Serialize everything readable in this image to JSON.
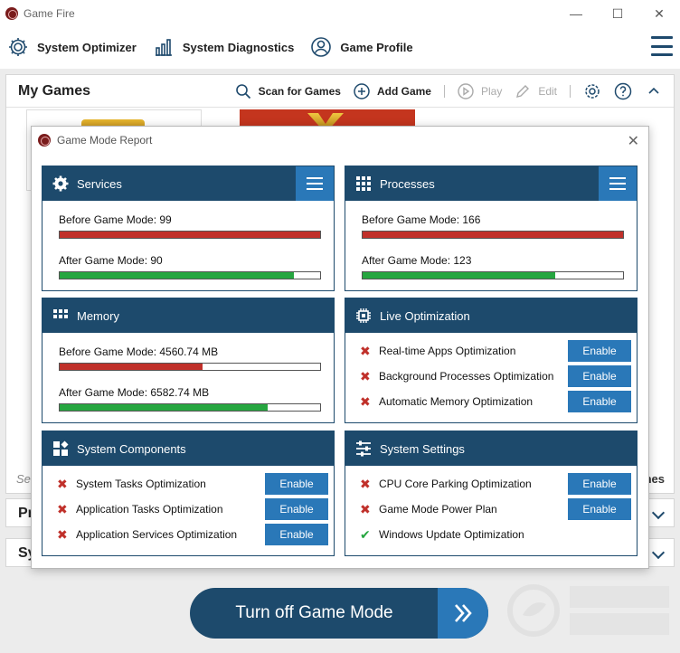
{
  "window": {
    "title": "Game Fire"
  },
  "nav": {
    "items": [
      {
        "label": "System Optimizer",
        "icon": "gear-icon"
      },
      {
        "label": "System Diagnostics",
        "icon": "bar-chart-icon"
      },
      {
        "label": "Game Profile",
        "icon": "user-icon"
      }
    ]
  },
  "games": {
    "title": "My Games",
    "scan_label": "Scan for Games",
    "add_label": "Add Game",
    "play_label": "Play",
    "edit_label": "Edit",
    "search_hint": "Se",
    "right_hint": "nes"
  },
  "collapsed": [
    {
      "label": "Pr"
    },
    {
      "label": "Sy"
    }
  ],
  "turnoff": {
    "label": "Turn off Game Mode"
  },
  "dialog": {
    "title": "Game Mode Report",
    "services": {
      "title": "Services",
      "before_label": "Before Game Mode: 99",
      "after_label": "After Game Mode: 90",
      "after_fraction": 0.9
    },
    "processes": {
      "title": "Processes",
      "before_label": "Before Game Mode: 166",
      "after_label": "After Game Mode: 123",
      "after_fraction": 0.74
    },
    "memory": {
      "title": "Memory",
      "before_label": "Before Game Mode: 4560.74 MB",
      "after_label": "After Game Mode: 6582.74 MB",
      "before_fraction": 0.55,
      "after_fraction": 0.8
    },
    "live": {
      "title": "Live Optimization",
      "rows": [
        {
          "label": "Real-time Apps Optimization",
          "status": "x",
          "action": "Enable"
        },
        {
          "label": "Background Processes Optimization",
          "status": "x",
          "action": "Enable"
        },
        {
          "label": "Automatic Memory Optimization",
          "status": "x",
          "action": "Enable"
        }
      ]
    },
    "components": {
      "title": "System Components",
      "rows": [
        {
          "label": "System Tasks Optimization",
          "status": "x",
          "action": "Enable"
        },
        {
          "label": "Application Tasks Optimization",
          "status": "x",
          "action": "Enable"
        },
        {
          "label": "Application Services Optimization",
          "status": "x",
          "action": "Enable"
        }
      ]
    },
    "settings": {
      "title": "System Settings",
      "rows": [
        {
          "label": "CPU Core Parking Optimization",
          "status": "x",
          "action": "Enable"
        },
        {
          "label": "Game Mode Power Plan",
          "status": "x",
          "action": "Enable"
        },
        {
          "label": "Windows Update Optimization",
          "status": "ok",
          "action": ""
        }
      ]
    }
  },
  "colors": {
    "primary": "#1d4a6c",
    "accent": "#2a78b8",
    "bad": "#c0302a",
    "good": "#26a640"
  }
}
